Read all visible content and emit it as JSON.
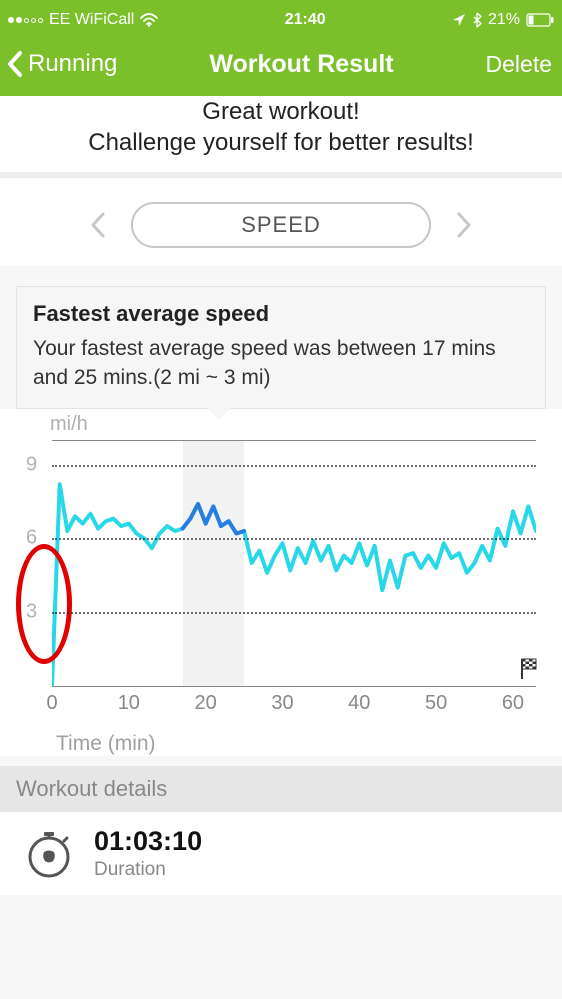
{
  "status": {
    "signal_filled": 2,
    "carrier": "EE WiFiCall",
    "time": "21:40",
    "battery_pct": "21%"
  },
  "nav": {
    "back_label": "Running",
    "title": "Workout Result",
    "delete_label": "Delete"
  },
  "hero": {
    "line1": "Great workout!",
    "line2": "Challenge yourself for better results!"
  },
  "metric": {
    "label": "SPEED"
  },
  "insight": {
    "title": "Fastest average speed",
    "body": "Your fastest average speed was between 17 mins and 25 mins.(2 mi ~ 3 mi)"
  },
  "chart_data": {
    "type": "line",
    "title": "",
    "xlabel": "Time (min)",
    "ylabel": "mi/h",
    "y_ticks": [
      3,
      6,
      9
    ],
    "ylim": [
      0,
      10
    ],
    "xlim": [
      0,
      63
    ],
    "x_ticks": [
      0,
      10,
      20,
      30,
      40,
      50,
      60
    ],
    "highlight": {
      "x_start": 17,
      "x_end": 25
    },
    "series": [
      {
        "name": "speed",
        "x": [
          0,
          1,
          2,
          3,
          4,
          5,
          6,
          7,
          8,
          9,
          10,
          11,
          12,
          13,
          14,
          15,
          16,
          17,
          18,
          19,
          20,
          21,
          22,
          23,
          24,
          25,
          26,
          27,
          28,
          29,
          30,
          31,
          32,
          33,
          34,
          35,
          36,
          37,
          38,
          39,
          40,
          41,
          42,
          43,
          44,
          45,
          46,
          47,
          48,
          49,
          50,
          51,
          52,
          53,
          54,
          55,
          56,
          57,
          58,
          59,
          60,
          61,
          62,
          63
        ],
        "values": [
          0,
          8.2,
          6.3,
          6.9,
          6.6,
          7.0,
          6.4,
          6.7,
          6.8,
          6.5,
          6.6,
          6.2,
          6.0,
          5.6,
          6.2,
          6.5,
          6.3,
          6.4,
          6.8,
          7.4,
          6.6,
          7.3,
          6.5,
          6.7,
          6.2,
          6.3,
          5.0,
          5.5,
          4.6,
          5.3,
          5.8,
          4.7,
          5.6,
          5.0,
          5.9,
          5.1,
          5.7,
          4.7,
          5.3,
          5.0,
          5.8,
          4.9,
          5.7,
          3.9,
          5.1,
          4.0,
          5.3,
          5.4,
          4.8,
          5.3,
          4.8,
          5.8,
          5.2,
          5.4,
          4.6,
          5.0,
          5.7,
          5.1,
          6.4,
          5.7,
          7.1,
          6.2,
          7.3,
          6.3
        ]
      }
    ]
  },
  "details": {
    "header": "Workout details",
    "duration_value": "01:03:10",
    "duration_label": "Duration"
  }
}
